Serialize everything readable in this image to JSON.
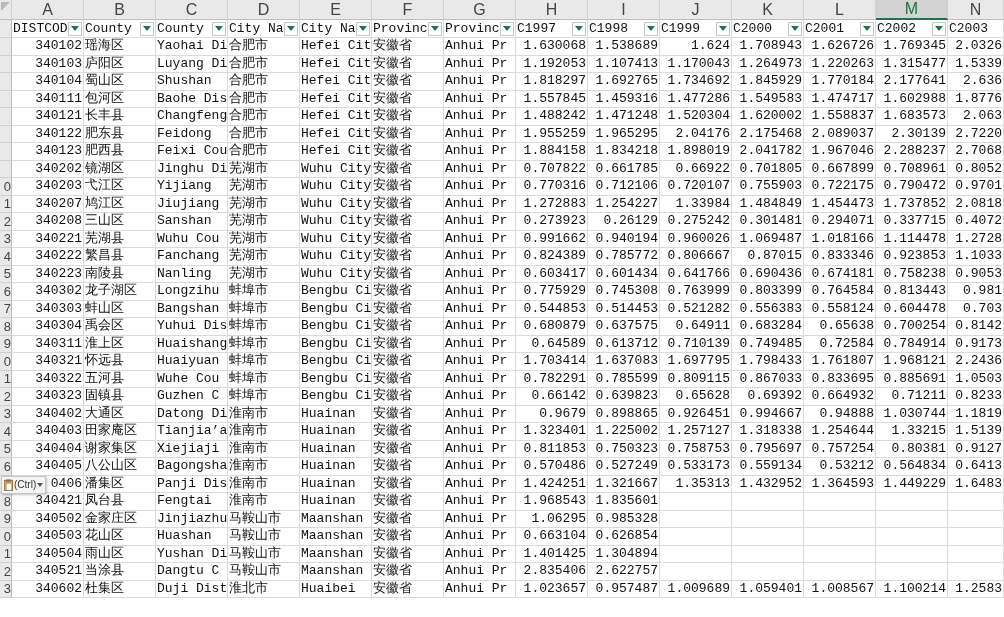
{
  "column_headers": [
    {
      "label": "A",
      "selected": false
    },
    {
      "label": "B",
      "selected": false
    },
    {
      "label": "C",
      "selected": false
    },
    {
      "label": "D",
      "selected": false
    },
    {
      "label": "E",
      "selected": false
    },
    {
      "label": "F",
      "selected": false
    },
    {
      "label": "G",
      "selected": false
    },
    {
      "label": "H",
      "selected": false
    },
    {
      "label": "I",
      "selected": false
    },
    {
      "label": "J",
      "selected": false
    },
    {
      "label": "K",
      "selected": false
    },
    {
      "label": "L",
      "selected": false
    },
    {
      "label": "M",
      "selected": true
    },
    {
      "label": "N",
      "selected": false
    }
  ],
  "header_row": [
    {
      "label": "DISTCOD",
      "filter": true
    },
    {
      "label": "County",
      "filter": true
    },
    {
      "label": "County",
      "filter": true
    },
    {
      "label": "City Na",
      "filter": true
    },
    {
      "label": "City Na",
      "filter": true
    },
    {
      "label": "Provinc",
      "filter": true
    },
    {
      "label": "Provinc",
      "filter": true
    },
    {
      "label": "C1997",
      "filter": true
    },
    {
      "label": "C1998",
      "filter": true
    },
    {
      "label": "C1999",
      "filter": true
    },
    {
      "label": "C2000",
      "filter": true
    },
    {
      "label": "C2001",
      "filter": true
    },
    {
      "label": "C2002",
      "filter": true
    },
    {
      "label": "C2003",
      "filter": false
    }
  ],
  "rows": [
    {
      "cells": [
        "340102",
        "瑶海区",
        "Yaohai Di",
        "合肥市",
        "Hefei Cit",
        "安徽省",
        "Anhui Pr",
        "1.630068",
        "1.538689",
        "1.624",
        "1.708943",
        "1.626726",
        "1.769345",
        "2.0326"
      ]
    },
    {
      "cells": [
        "340103",
        "庐阳区",
        "Luyang Di",
        "合肥市",
        "Hefei Cit",
        "安徽省",
        "Anhui Pr",
        "1.192053",
        "1.107413",
        "1.170043",
        "1.264973",
        "1.220263",
        "1.315477",
        "1.5339"
      ]
    },
    {
      "cells": [
        "340104",
        "蜀山区",
        "Shushan",
        "合肥市",
        "Hefei Cit",
        "安徽省",
        "Anhui Pr",
        "1.818297",
        "1.692765",
        "1.734692",
        "1.845929",
        "1.770184",
        "2.177641",
        "2.636"
      ]
    },
    {
      "cells": [
        "340111",
        "包河区",
        "Baohe Dis",
        "合肥市",
        "Hefei Cit",
        "安徽省",
        "Anhui Pr",
        "1.557845",
        "1.459316",
        "1.477286",
        "1.549583",
        "1.474717",
        "1.602988",
        "1.8776"
      ]
    },
    {
      "cells": [
        "340121",
        "长丰县",
        "Changfeng",
        "合肥市",
        "Hefei Cit",
        "安徽省",
        "Anhui Pr",
        "1.488242",
        "1.471248",
        "1.520304",
        "1.620002",
        "1.558837",
        "1.683573",
        "2.063"
      ]
    },
    {
      "cells": [
        "340122",
        "肥东县",
        "Feidong",
        "合肥市",
        "Hefei Cit",
        "安徽省",
        "Anhui Pr",
        "1.955259",
        "1.965295",
        "2.04176",
        "2.175468",
        "2.089037",
        "2.30139",
        "2.7220"
      ]
    },
    {
      "cells": [
        "340123",
        "肥西县",
        "Feixi Cou",
        "合肥市",
        "Hefei Cit",
        "安徽省",
        "Anhui Pr",
        "1.884158",
        "1.834218",
        "1.898019",
        "2.041782",
        "1.967046",
        "2.288237",
        "2.7068"
      ]
    },
    {
      "cells": [
        "340202",
        "镜湖区",
        "Jinghu Di",
        "芜湖市",
        "Wuhu City",
        "安徽省",
        "Anhui Pr",
        "0.707822",
        "0.661785",
        "0.66922",
        "0.701805",
        "0.667899",
        "0.708961",
        "0.8052"
      ]
    },
    {
      "row_number": "0",
      "cells": [
        "340203",
        "弋江区",
        "Yijiang",
        "芜湖市",
        "Wuhu City",
        "安徽省",
        "Anhui Pr",
        "0.770316",
        "0.712106",
        "0.720107",
        "0.755903",
        "0.722175",
        "0.790472",
        "0.9701"
      ]
    },
    {
      "row_number": "1",
      "cells": [
        "340207",
        "鸠江区",
        "Jiujiang",
        "芜湖市",
        "Wuhu City",
        "安徽省",
        "Anhui Pr",
        "1.272883",
        "1.254227",
        "1.33984",
        "1.484849",
        "1.454473",
        "1.737852",
        "2.0818"
      ]
    },
    {
      "row_number": "2",
      "cells": [
        "340208",
        "三山区",
        "Sanshan",
        "芜湖市",
        "Wuhu City",
        "安徽省",
        "Anhui Pr",
        "0.273923",
        "0.26129",
        "0.275242",
        "0.301481",
        "0.294071",
        "0.337715",
        "0.4072"
      ]
    },
    {
      "row_number": "3",
      "cells": [
        "340221",
        "芜湖县",
        "Wuhu Cou",
        "芜湖市",
        "Wuhu City",
        "安徽省",
        "Anhui Pr",
        "0.991662",
        "0.940194",
        "0.960026",
        "1.069487",
        "1.018166",
        "1.114478",
        "1.2728"
      ]
    },
    {
      "row_number": "4",
      "cells": [
        "340222",
        "繁昌县",
        "Fanchang",
        "芜湖市",
        "Wuhu City",
        "安徽省",
        "Anhui Pr",
        "0.824389",
        "0.785772",
        "0.806667",
        "0.87015",
        "0.833346",
        "0.923853",
        "1.1033"
      ]
    },
    {
      "row_number": "5",
      "cells": [
        "340223",
        "南陵县",
        "Nanling",
        "芜湖市",
        "Wuhu City",
        "安徽省",
        "Anhui Pr",
        "0.603417",
        "0.601434",
        "0.641766",
        "0.690436",
        "0.674181",
        "0.758238",
        "0.9053"
      ]
    },
    {
      "row_number": "6",
      "cells": [
        "340302",
        "龙子湖区",
        "Longzihu",
        "蚌埠市",
        "Bengbu Ci",
        "安徽省",
        "Anhui Pr",
        "0.775929",
        "0.745308",
        "0.763999",
        "0.803399",
        "0.764584",
        "0.813443",
        "0.981"
      ]
    },
    {
      "row_number": "7",
      "cells": [
        "340303",
        "蚌山区",
        "Bangshan",
        "蚌埠市",
        "Bengbu Ci",
        "安徽省",
        "Anhui Pr",
        "0.544853",
        "0.514453",
        "0.521282",
        "0.556383",
        "0.558124",
        "0.604478",
        "0.703"
      ]
    },
    {
      "row_number": "8",
      "cells": [
        "340304",
        "禹会区",
        "Yuhui Dis",
        "蚌埠市",
        "Bengbu Ci",
        "安徽省",
        "Anhui Pr",
        "0.680879",
        "0.637575",
        "0.64911",
        "0.683284",
        "0.65638",
        "0.700254",
        "0.8142"
      ]
    },
    {
      "row_number": "9",
      "cells": [
        "340311",
        "淮上区",
        "Huaishang",
        "蚌埠市",
        "Bengbu Ci",
        "安徽省",
        "Anhui Pr",
        "0.64589",
        "0.613712",
        "0.710139",
        "0.749485",
        "0.72584",
        "0.784914",
        "0.9173"
      ]
    },
    {
      "row_number": "0",
      "cells": [
        "340321",
        "怀远县",
        "Huaiyuan",
        "蚌埠市",
        "Bengbu Ci",
        "安徽省",
        "Anhui Pr",
        "1.703414",
        "1.637083",
        "1.697795",
        "1.798433",
        "1.761807",
        "1.968121",
        "2.2436"
      ]
    },
    {
      "row_number": "1",
      "cells": [
        "340322",
        "五河县",
        "Wuhe Cou",
        "蚌埠市",
        "Bengbu Ci",
        "安徽省",
        "Anhui Pr",
        "0.782291",
        "0.785599",
        "0.809115",
        "0.867033",
        "0.833695",
        "0.885691",
        "1.0503"
      ]
    },
    {
      "row_number": "2",
      "cells": [
        "340323",
        "固镇县",
        "Guzhen C",
        "蚌埠市",
        "Bengbu Ci",
        "安徽省",
        "Anhui Pr",
        "0.66142",
        "0.639823",
        "0.65628",
        "0.69392",
        "0.664932",
        "0.71211",
        "0.8233"
      ]
    },
    {
      "row_number": "3",
      "cells": [
        "340402",
        "大通区",
        "Datong Di",
        "淮南市",
        "Huainan",
        "安徽省",
        "Anhui Pr",
        "0.9679",
        "0.898865",
        "0.926451",
        "0.994667",
        "0.94888",
        "1.030744",
        "1.1819"
      ]
    },
    {
      "row_number": "4",
      "cells": [
        "340403",
        "田家庵区",
        "Tianjia’a",
        "淮南市",
        "Huainan",
        "安徽省",
        "Anhui Pr",
        "1.323401",
        "1.225002",
        "1.257127",
        "1.318338",
        "1.254644",
        "1.33215",
        "1.5139"
      ]
    },
    {
      "row_number": "5",
      "cells": [
        "340404",
        "谢家集区",
        "Xiejiaji",
        "淮南市",
        "Huainan",
        "安徽省",
        "Anhui Pr",
        "0.811853",
        "0.750323",
        "0.758753",
        "0.795697",
        "0.757254",
        "0.80381",
        "0.9127"
      ]
    },
    {
      "row_number": "6",
      "cells": [
        "340405",
        "八公山区",
        "Bagongsha",
        "淮南市",
        "Huainan",
        "安徽省",
        "Anhui Pr",
        "0.570486",
        "0.527249",
        "0.533173",
        "0.559134",
        "0.53212",
        "0.564834",
        "0.6413"
      ]
    },
    {
      "cells": [
        "0406",
        "潘集区",
        "Panji Dis",
        "淮南市",
        "Huainan",
        "安徽省",
        "Anhui Pr",
        "1.424251",
        "1.321667",
        "1.35313",
        "1.432952",
        "1.364593",
        "1.449229",
        "1.6483"
      ]
    },
    {
      "row_number": "8",
      "cells": [
        "340421",
        "凤台县",
        "Fengtai",
        "淮南市",
        "Huainan",
        "安徽省",
        "Anhui Pr",
        "1.968543",
        "1.835601",
        null,
        null,
        null,
        null,
        null
      ]
    },
    {
      "row_number": "9",
      "cells": [
        "340502",
        "金家庄区",
        "Jinjiazhu",
        "马鞍山市",
        "Maanshan",
        "安徽省",
        "Anhui Pr",
        "1.06295",
        "0.985328",
        null,
        null,
        null,
        null,
        null
      ]
    },
    {
      "row_number": "0",
      "cells": [
        "340503",
        "花山区",
        "Huashan",
        "马鞍山市",
        "Maanshan",
        "安徽省",
        "Anhui Pr",
        "0.663104",
        "0.626854",
        null,
        null,
        null,
        null,
        null
      ]
    },
    {
      "row_number": "1",
      "cells": [
        "340504",
        "雨山区",
        "Yushan Di",
        "马鞍山市",
        "Maanshan",
        "安徽省",
        "Anhui Pr",
        "1.401425",
        "1.304894",
        null,
        null,
        null,
        null,
        null
      ]
    },
    {
      "row_number": "2",
      "cells": [
        "340521",
        "当涂县",
        "Dangtu C",
        "马鞍山市",
        "Maanshan",
        "安徽省",
        "Anhui Pr",
        "2.835406",
        "2.622757",
        null,
        null,
        null,
        null,
        null
      ]
    },
    {
      "row_number": "3",
      "cells": [
        "340602",
        "杜集区",
        "Duji Dist",
        "淮北市",
        "Huaibei",
        "安徽省",
        "Anhui Pr",
        "1.023657",
        "0.957487",
        "1.009689",
        "1.059401",
        "1.008567",
        "1.100214",
        "1.2583"
      ]
    }
  ],
  "paste_options": {
    "label": "(Ctrl)"
  }
}
